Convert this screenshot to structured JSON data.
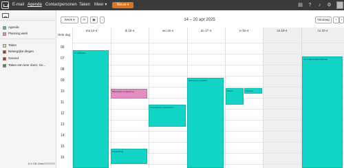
{
  "app": {
    "nav": [
      "E-mail",
      "Agenda",
      "Contactpersonen",
      "Taken",
      "Meer ▾"
    ],
    "active_nav": "Agenda",
    "new_button": "Nieuw ▾",
    "accent": "#e2731b"
  },
  "sidebar": {
    "calendars_top": [
      {
        "label": "Agenda",
        "color": "#11d4c4"
      },
      {
        "label": "Planning werk",
        "color": "#e48dc0"
      }
    ],
    "calendars_bottom": [
      {
        "label": "Taken",
        "color": "#f2e24a"
      },
      {
        "label": "Belangrijke dingen",
        "color": "#d22222"
      },
      {
        "label": "Gereed",
        "color": "#d22222"
      },
      {
        "label": "Taken een keer doen; Ge...",
        "color": "#3a9a3a"
      }
    ],
    "storage": "6.6 GB Gebruikt"
  },
  "toolbar": {
    "view_select": "Week ▾",
    "date_range": "14 – 20 apr 2025",
    "today_button": "Vandaag"
  },
  "calendar": {
    "allday_label": "Hele dag",
    "days": [
      "ma 14-4",
      "di 15-4",
      "wo 16-4",
      "do 17-4",
      "vr 18-4",
      "za 19-4",
      "zo 20-4"
    ],
    "hours": [
      "06",
      "07",
      "08",
      "09",
      "10",
      "11",
      "12",
      "13",
      "14",
      "15",
      "16"
    ],
    "events": [
      {
        "title": "In ontbreken",
        "calendar": "Agenda"
      },
      {
        "title": "Belangrijke vergadering",
        "calendar": "Planning werk"
      },
      {
        "title": "Samenkomen vergaderen",
        "calendar": "Agenda"
      },
      {
        "title": "Werkgroep uitstellen",
        "calendar": "Agenda"
      },
      {
        "title": "Nieuw ...",
        "calendar": "Agenda"
      },
      {
        "title": "Overlap",
        "calendar": "Agenda"
      },
      {
        "title": "Samengevoegde afspraak",
        "calendar": "Agenda"
      },
      {
        "title": "Vergadering",
        "calendar": "Agenda"
      }
    ]
  }
}
